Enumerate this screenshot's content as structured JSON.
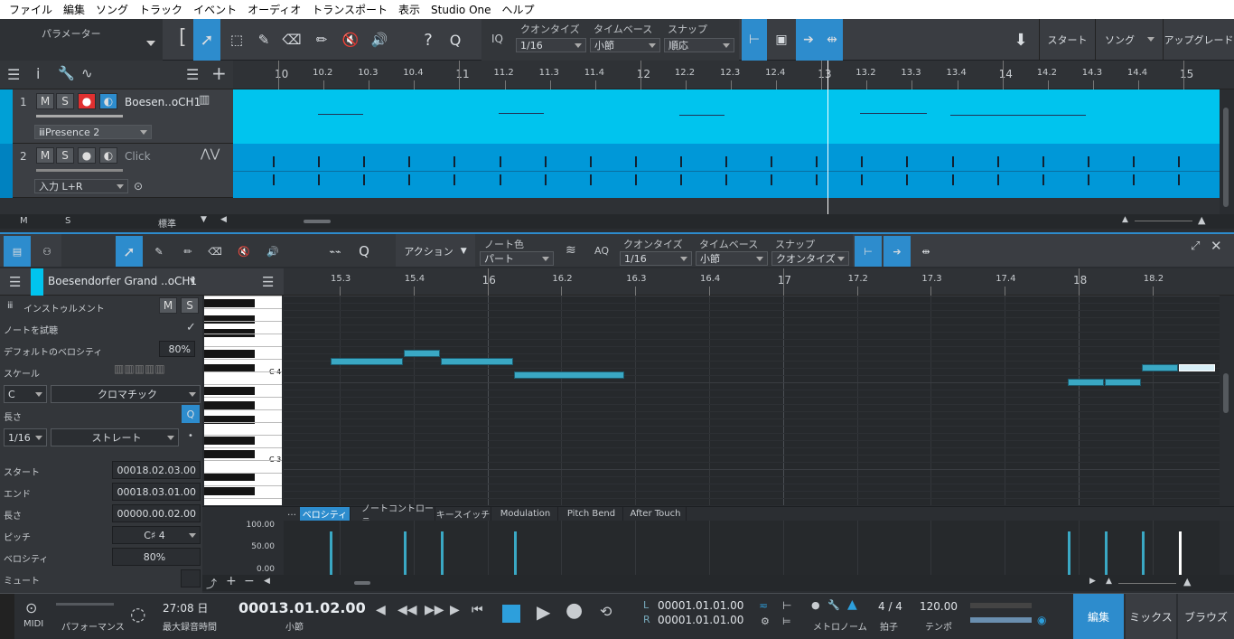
{
  "menu": [
    "ファイル",
    "編集",
    "ソング",
    "トラック",
    "イベント",
    "オーディオ",
    "トランスポート",
    "表示",
    "Studio One",
    "ヘルプ"
  ],
  "toolbar": {
    "param_label": "パラメーター",
    "iq": "IQ",
    "quantize_label": "クオンタイズ",
    "quantize_value": "1/16",
    "timebase_label": "タイムベース",
    "timebase_value": "小節",
    "snap_label": "スナップ",
    "snap_value": "順応",
    "start": "スタート",
    "song": "ソング",
    "upgrade": "アップグレード"
  },
  "arrange_ruler": [
    "10",
    "10.2",
    "10.3",
    "10.4",
    "11",
    "11.2",
    "11.3",
    "11.4",
    "12",
    "12.2",
    "12.3",
    "12.4",
    "13",
    "13.2",
    "13.3",
    "13.4",
    "14",
    "14.2",
    "14.3",
    "14.4",
    "15"
  ],
  "tracks": [
    {
      "num": "1",
      "name": "Boesen..oCH1",
      "preset": "Presence 2"
    },
    {
      "num": "2",
      "name": "Click",
      "input": "入力 L+R"
    }
  ],
  "arrange_footer": {
    "m": "M",
    "s": "S",
    "mode": "標準"
  },
  "editor": {
    "action": "アクション",
    "note_color_label": "ノート色",
    "note_color_value": "パート",
    "aq": "AQ",
    "quantize_label": "クオンタイズ",
    "quantize_value": "1/16",
    "timebase_label": "タイムベース",
    "timebase_value": "小節",
    "snap_label": "スナップ",
    "snap_value": "クオンタイズ",
    "instrument_name": "Boesendorfer Grand ..oCH1",
    "ruler": [
      "15.3",
      "15.4",
      "16",
      "16.2",
      "16.3",
      "16.4",
      "17",
      "17.2",
      "17.3",
      "17.4",
      "18",
      "18.2"
    ],
    "inspector": {
      "instrument": "インストゥルメント",
      "m": "M",
      "s": "S",
      "audition": "ノートを試聴",
      "default_vel_label": "デフォルトのベロシティ",
      "default_vel": "80%",
      "scale": "スケール",
      "scale_root": "C",
      "scale_type": "クロマチック",
      "length_label": "長さ",
      "q": "Q",
      "length_value": "1/16",
      "length_type": "ストレート",
      "start_label": "スタート",
      "start_value": "00018.02.03.00",
      "end_label": "エンド",
      "end_value": "00018.03.01.00",
      "len_label": "長さ",
      "len_value": "00000.00.02.00",
      "pitch_label": "ピッチ",
      "pitch_value": "C♯ 4",
      "vel_label": "ベロシティ",
      "vel_value": "80%",
      "mute_label": "ミュート"
    },
    "keys": {
      "c4": "C 4",
      "c3": "C 3"
    },
    "tabs": [
      "ベロシティ",
      "ノートコントローラー",
      "キースイッチ",
      "Modulation",
      "Pitch Bend",
      "After Touch"
    ],
    "vel_axis": [
      "100.00",
      "50.00",
      "0.00"
    ]
  },
  "transport": {
    "midi": "MIDI",
    "performance": "パフォーマンス",
    "rec_time": "27:08 日",
    "rec_label": "最大録音時間",
    "position": "00013.01.02.00",
    "position_label": "小節",
    "loop_l": "00001.01.01.00",
    "loop_r": "00001.01.01.00",
    "l": "L",
    "r": "R",
    "metronome": "メトロノーム",
    "sig": "4 / 4",
    "sig_label": "拍子",
    "tempo": "120.00",
    "tempo_label": "テンポ",
    "edit": "編集",
    "mix": "ミックス",
    "browse": "ブラウズ"
  },
  "colors": {
    "accent": "#2d8ccd",
    "track1": "#00c4ee",
    "track2": "#0098d8",
    "note": "#3aa8c4"
  }
}
